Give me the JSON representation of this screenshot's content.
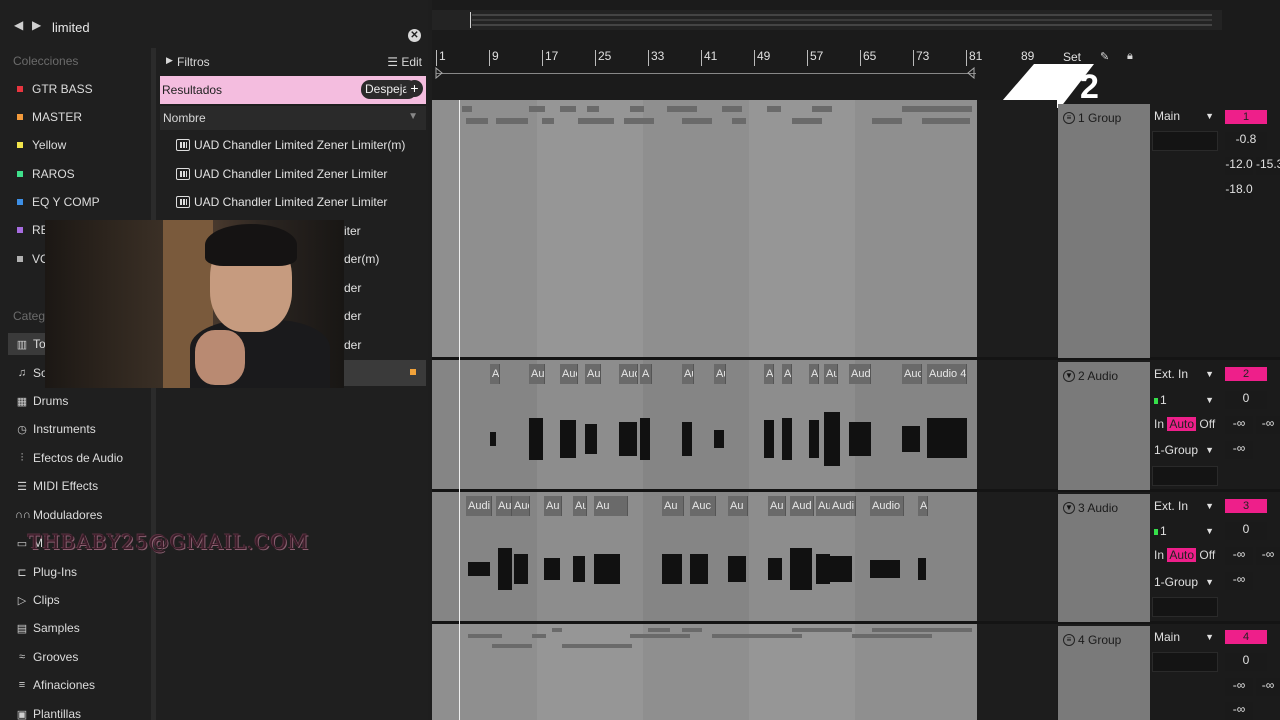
{
  "browser": {
    "search_text": "limited",
    "nav_back": "◀",
    "nav_fwd": "▶",
    "clear": "✕",
    "collections_title": "Colecciones",
    "collections": [
      {
        "label": "GTR BASS",
        "color": "#e8353f"
      },
      {
        "label": "MASTER",
        "color": "#f39a3b"
      },
      {
        "label": "Yellow",
        "color": "#f1e44b"
      },
      {
        "label": "RAROS",
        "color": "#3fe08b"
      },
      {
        "label": "EQ Y COMP",
        "color": "#3d8fe6"
      },
      {
        "label": "RE",
        "color": "#a66ce0"
      },
      {
        "label": "VO",
        "color": "#b0b0b0"
      }
    ],
    "categories_title": "Catego",
    "categories": [
      {
        "label": "To",
        "icon": "grid-icon",
        "glyph": "▥"
      },
      {
        "label": "Sou",
        "icon": "note-icon",
        "glyph": "♫"
      },
      {
        "label": "Drums",
        "icon": "drums-icon",
        "glyph": "▦"
      },
      {
        "label": "Instruments",
        "icon": "instrument-icon",
        "glyph": "◷"
      },
      {
        "label": "Efectos de Audio",
        "icon": "audio-effects-icon",
        "glyph": "⫶"
      },
      {
        "label": "MIDI Effects",
        "icon": "midi-effects-icon",
        "glyph": "☰"
      },
      {
        "label": "Moduladores",
        "icon": "modulators-icon",
        "glyph": "∩∩"
      },
      {
        "label": "M",
        "icon": "max-icon",
        "glyph": "▭"
      },
      {
        "label": "Plug-Ins",
        "icon": "plugins-icon",
        "glyph": "⊏"
      },
      {
        "label": "Clips",
        "icon": "clips-icon",
        "glyph": "▷"
      },
      {
        "label": "Samples",
        "icon": "samples-icon",
        "glyph": "▤"
      },
      {
        "label": "Grooves",
        "icon": "grooves-icon",
        "glyph": "≈"
      },
      {
        "label": "Afinaciones",
        "icon": "tunings-icon",
        "glyph": "≡"
      },
      {
        "label": "Plantillas",
        "icon": "templates-icon",
        "glyph": "▣"
      }
    ],
    "filtros_label": "Filtros",
    "edit_label": "Edit",
    "resultados_label": "Resultados",
    "despejar_label": "Despejar",
    "add_label": "+",
    "nombre_header": "Nombre",
    "results": [
      "UAD Chandler Limited Zener Limiter(m)",
      "UAD Chandler Limited Zener Limiter",
      "UAD Chandler Limited Zener Limiter",
      "iter",
      "der(m)",
      "der",
      "der",
      "der"
    ],
    "watermark": "THBABY25@GMAIL.COM"
  },
  "arrangement": {
    "ruler": [
      "1",
      "9",
      "17",
      "25",
      "33",
      "41",
      "49",
      "57",
      "65",
      "73",
      "81",
      "89"
    ],
    "set_label": "Set",
    "logo_text": "2",
    "track2_clips": [
      "A",
      "Au",
      "Auc",
      "Au",
      "Aud",
      "A",
      "Au",
      "Au",
      "A",
      "A",
      "A",
      "Au",
      "Aud",
      "Auc",
      "Audio 4"
    ],
    "track3_clips": [
      "Audi",
      "Au",
      "Auc",
      "Au",
      "Audio",
      "Au",
      "Au",
      "Auc",
      "Au",
      "Au",
      "Aud",
      "Au",
      "Audi",
      "Audio",
      "A"
    ]
  },
  "tracks": [
    {
      "name": "1 Group",
      "fold": "≡",
      "io": "Main",
      "num": "1",
      "vals": [
        "-0.8",
        "-12.0",
        "-15.3",
        "-18.0"
      ]
    },
    {
      "name": "2 Audio",
      "fold": "▼",
      "io": "Ext. In",
      "input": "1",
      "num": "2",
      "vol": "0",
      "in": "In",
      "auto": "Auto",
      "off": "Off",
      "out": "1-Group",
      "inf1": "-∞",
      "inf2": "-∞",
      "inf3": "-∞"
    },
    {
      "name": "3 Audio",
      "fold": "▼",
      "io": "Ext. In",
      "input": "1",
      "num": "3",
      "vol": "0",
      "in": "In",
      "auto": "Auto",
      "off": "Off",
      "out": "1-Group",
      "inf1": "-∞",
      "inf2": "-∞",
      "inf3": "-∞"
    },
    {
      "name": "4 Group",
      "fold": "≡",
      "io": "Main",
      "num": "4",
      "vol": "0",
      "inf1": "-∞",
      "inf2": "-∞",
      "inf3": "-∞"
    }
  ]
}
